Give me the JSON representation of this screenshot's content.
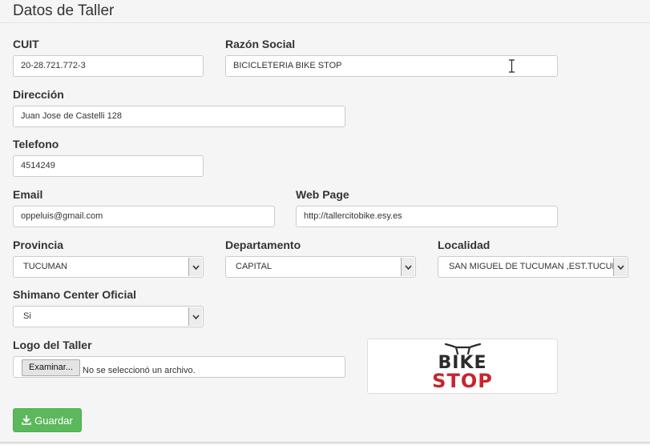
{
  "page": {
    "title": "Datos de Taller"
  },
  "form": {
    "cuit": {
      "label": "CUIT",
      "value": "20-28.721.772-3"
    },
    "razon_social": {
      "label": "Razón Social",
      "value": "BICICLETERIA BIKE STOP"
    },
    "direccion": {
      "label": "Dirección",
      "value": "Juan Jose de Castelli 128"
    },
    "telefono": {
      "label": "Telefono",
      "value": "4514249"
    },
    "email": {
      "label": "Email",
      "value": "oppeluis@gmail.com"
    },
    "web_page": {
      "label": "Web Page",
      "value": "http://tallercitobike.esy.es"
    },
    "provincia": {
      "label": "Provincia",
      "value": "TUCUMAN"
    },
    "departamento": {
      "label": "Departamento",
      "value": "CAPITAL"
    },
    "localidad": {
      "label": "Localidad",
      "value": "SAN MIGUEL DE TUCUMAN ,EST.TUCUMA"
    },
    "shimano": {
      "label": "Shimano Center Oficial",
      "value": "Si"
    },
    "logo": {
      "label": "Logo del Taller",
      "browse_label": "Examinar...",
      "status": "No se seleccionó un archivo.",
      "image_text_top": "BIKE",
      "image_text_bottom": "STOP"
    }
  },
  "actions": {
    "save_label": "Guardar"
  },
  "colors": {
    "primary_button": "#5cb85c",
    "logo_red": "#c8252c",
    "logo_dark": "#2b2b2b"
  },
  "icons": {
    "save": "download-icon",
    "select_arrow": "chevron-down-icon",
    "cursor": "text-cursor-icon"
  }
}
